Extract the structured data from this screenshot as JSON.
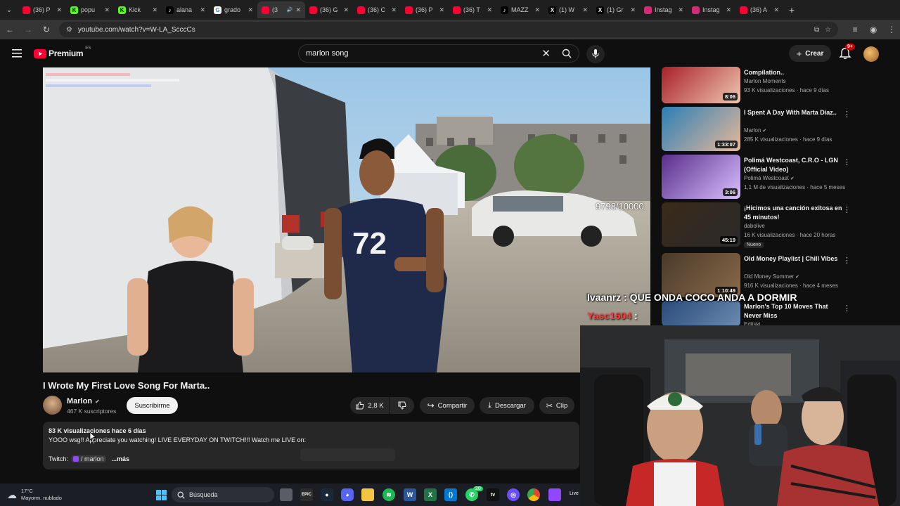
{
  "browser": {
    "tabs": [
      {
        "label": "(36) P",
        "favicon": "youtube-favicon",
        "color": "#ff0033",
        "active": false
      },
      {
        "label": "popu",
        "favicon": "kick-favicon",
        "color": "#53fc18",
        "active": false
      },
      {
        "label": "Kick",
        "favicon": "kick-favicon",
        "color": "#53fc18",
        "active": false
      },
      {
        "label": "alana",
        "favicon": "tiktok-favicon",
        "color": "#000000",
        "active": false
      },
      {
        "label": "grado",
        "favicon": "google-favicon",
        "color": "#4285f4",
        "active": false
      },
      {
        "label": "(3",
        "favicon": "youtube-favicon",
        "color": "#ff0033",
        "active": true
      },
      {
        "label": "(36) G",
        "favicon": "youtube-favicon",
        "color": "#ff0033",
        "active": false
      },
      {
        "label": "(36) C",
        "favicon": "youtube-favicon",
        "color": "#ff0033",
        "active": false
      },
      {
        "label": "(36) P",
        "favicon": "youtube-favicon",
        "color": "#ff0033",
        "active": false
      },
      {
        "label": "(36) T",
        "favicon": "youtube-favicon",
        "color": "#ff0033",
        "active": false
      },
      {
        "label": "MAZZ",
        "favicon": "tiktok-favicon",
        "color": "#000000",
        "active": false
      },
      {
        "label": "(1) W",
        "favicon": "x-favicon",
        "color": "#000000",
        "active": false
      },
      {
        "label": "(1) Gr",
        "favicon": "x-favicon",
        "color": "#000000",
        "active": false
      },
      {
        "label": "Instag",
        "favicon": "instagram-favicon",
        "color": "#d62976",
        "active": false
      },
      {
        "label": "Instag",
        "favicon": "instagram-favicon",
        "color": "#d62976",
        "active": false
      },
      {
        "label": "(36) A",
        "favicon": "youtube-favicon",
        "color": "#ff0033",
        "active": false
      }
    ],
    "url": "youtube.com/watch?v=W-LA_ScccCs"
  },
  "youtube": {
    "logo_text": "Premium",
    "logo_region": "ES",
    "search_query": "marlon song",
    "create_label": "Crear",
    "notif_count": "9+"
  },
  "player": {
    "overlay_counter": "9798/10000"
  },
  "video": {
    "title": "I Wrote My First Love Song For Marta..",
    "channel": "Marlon",
    "subscribers": "467 K suscriptores",
    "subscribe_label": "Suscribirme",
    "likes": "2,8 K",
    "share_label": "Compartir",
    "download_label": "Descargar",
    "clip_label": "Clip"
  },
  "description": {
    "meta": "83 K visualizaciones  hace 6 días",
    "text": "YOOO wsg!! Appreciate you watching! LIVE EVERYDAY ON TWITCH!!! Watch me LIVE on:",
    "twitch_label": "Twitch:",
    "twitch_link": "/ marlon",
    "more_label": "...más"
  },
  "recommendations": [
    {
      "title": "Compilation..",
      "channel": "Marlon Moments",
      "meta": "93 K visualizaciones · hace 9 días",
      "duration": "8:06",
      "verified": false,
      "badge": ""
    },
    {
      "title": "I Spent A Day With Marta Diaz..",
      "channel": "Marlon",
      "meta": "285 K visualizaciones · hace 9 días",
      "duration": "1:33:07",
      "verified": true,
      "badge": ""
    },
    {
      "title": "Polimá Westcoast, C.R.O - LGN (Official Video)",
      "channel": "Polimá Westcoast",
      "meta": "1,1 M de visualizaciones · hace 5 meses",
      "duration": "3:06",
      "verified": true,
      "badge": ""
    },
    {
      "title": "¡Hicimos una canción exitosa en 45 minutos!",
      "channel": "dabolive",
      "meta": "16 K visualizaciones · hace 20 horas",
      "duration": "45:19",
      "verified": false,
      "badge": "Nuevo"
    },
    {
      "title": "Old Money Playlist | Chill Vibes",
      "channel": "Old Money Summer",
      "meta": "916 K visualizaciones · hace 4 meses",
      "duration": "1:10:49",
      "verified": true,
      "badge": ""
    },
    {
      "title": "Marlon's Top 10 Moves That Never Miss",
      "channel": "Editski",
      "meta": "",
      "duration": "",
      "verified": false,
      "badge": ""
    }
  ],
  "stream": {
    "chat_user_1": "Ivaanrz",
    "chat_msg_1": "QUE ONDA COCO ANDA A DORMIR",
    "chat_user_2": "Yasc1604"
  },
  "taskbar": {
    "temperature": "17°C",
    "weather": "Mayorm. nublado",
    "search_label": "Búsqueda",
    "whatsapp_badge": "20",
    "live_label": "Live"
  }
}
